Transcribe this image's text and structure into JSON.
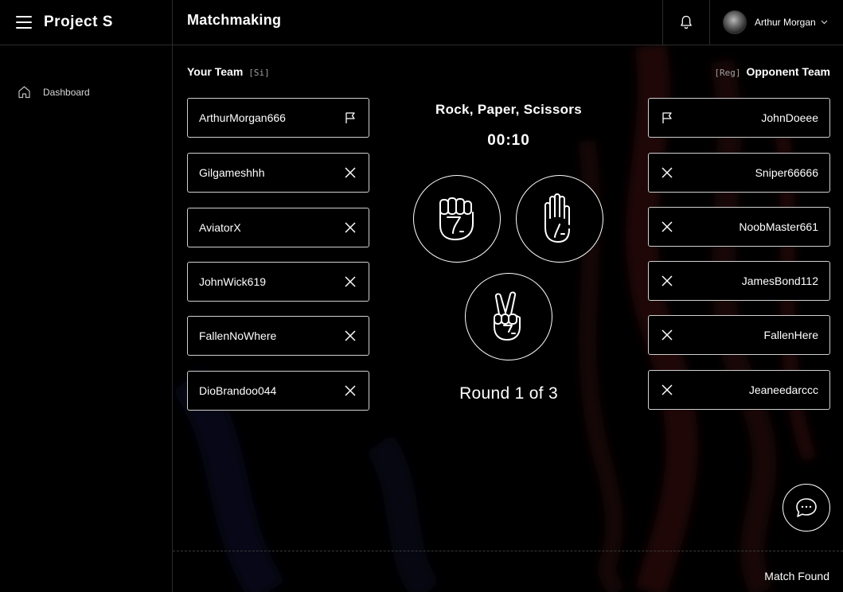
{
  "app": {
    "brand": "Project S",
    "page_title": "Matchmaking"
  },
  "header": {
    "user_name": "Arthur Morgan",
    "icons": {
      "menu": "hamburger-icon",
      "bell": "bell-icon",
      "chevron": "chevron-down-icon"
    }
  },
  "sidebar": {
    "items": [
      {
        "label": "Dashboard",
        "icon": "home-icon"
      }
    ]
  },
  "your_team": {
    "title": "Your Team",
    "tag": "[Si]",
    "players": [
      {
        "name": "ArthurMorgan666",
        "icon": "flag-icon"
      },
      {
        "name": "Gilgameshhh",
        "icon": "close-icon"
      },
      {
        "name": "AviatorX",
        "icon": "close-icon"
      },
      {
        "name": "JohnWick619",
        "icon": "close-icon"
      },
      {
        "name": "FallenNoWhere",
        "icon": "close-icon"
      },
      {
        "name": "DioBrandoo044",
        "icon": "close-icon"
      }
    ]
  },
  "opponent_team": {
    "title": "Opponent Team",
    "tag": "[Reg]",
    "players": [
      {
        "name": "JohnDoeee",
        "icon": "flag-icon"
      },
      {
        "name": "Sniper66666",
        "icon": "close-icon"
      },
      {
        "name": "NoobMaster661",
        "icon": "close-icon"
      },
      {
        "name": "JamesBond112",
        "icon": "close-icon"
      },
      {
        "name": "FallenHere",
        "icon": "close-icon"
      },
      {
        "name": "Jeaneedarccc",
        "icon": "close-icon"
      }
    ]
  },
  "game": {
    "title": "Rock, Paper, Scissors",
    "timer": "00:10",
    "round": "Round 1 of 3",
    "choices": [
      {
        "id": "rock",
        "icon": "fist-icon"
      },
      {
        "id": "paper",
        "icon": "open-hand-icon"
      },
      {
        "id": "scissors",
        "icon": "peace-hand-icon"
      }
    ]
  },
  "chat": {
    "icon": "chat-bubble-icon"
  },
  "footer": {
    "status": "Match Found"
  },
  "colors": {
    "background": "#000000",
    "foreground": "#ffffff",
    "border": "#d0d0d0",
    "muted": "#a0a0a0",
    "bg_accent_red": "#3a0a0a",
    "bg_accent_blue": "#0b0f2a"
  }
}
